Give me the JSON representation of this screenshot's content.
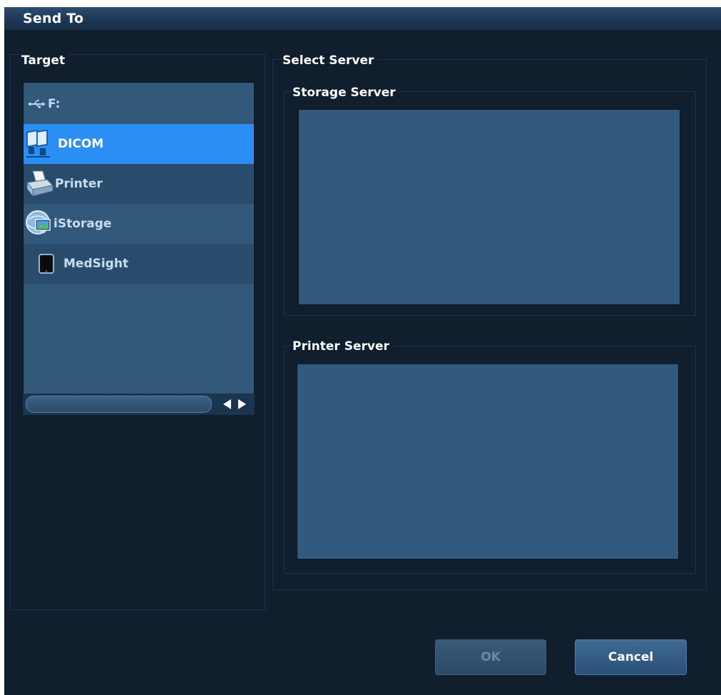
{
  "dialog": {
    "title": "Send To"
  },
  "target": {
    "label": "Target",
    "items": [
      {
        "label": "F:",
        "icon": "usb-icon",
        "selected": false
      },
      {
        "label": "DICOM",
        "icon": "dicom-network-icon",
        "selected": true
      },
      {
        "label": "Printer",
        "icon": "printer-icon",
        "selected": false
      },
      {
        "label": "iStorage",
        "icon": "istorage-globe-icon",
        "selected": false
      },
      {
        "label": "MedSight",
        "icon": "tablet-icon",
        "selected": false
      }
    ]
  },
  "select_server": {
    "label": "Select Server",
    "storage_server_label": "Storage Server",
    "printer_server_label": "Printer Server"
  },
  "buttons": {
    "ok_label": "OK",
    "cancel_label": "Cancel"
  },
  "colors": {
    "selection": "#2b8ef5",
    "panel": "#315a7e",
    "background": "#101e2e"
  }
}
